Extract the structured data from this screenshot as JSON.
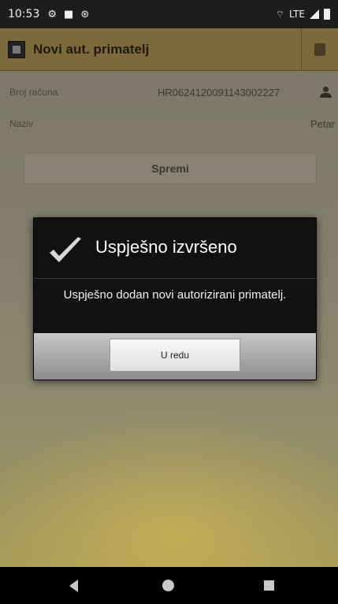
{
  "status_bar": {
    "time": "10:53",
    "network": "LTE"
  },
  "app": {
    "title": "Novi aut. primatelj",
    "fields": [
      {
        "label": "Broj računa",
        "value": "HR0624120091143002227"
      },
      {
        "label": "Naziv",
        "value": "Petar"
      }
    ],
    "save_button": "Spremi"
  },
  "dialog": {
    "title": "Uspješno izvršeno",
    "message": "Uspješno dodan novi autorizirani primatelj.",
    "ok_button": "U redu"
  },
  "icons": {
    "status": [
      "gear-icon",
      "sd-card-icon",
      "sync-icon"
    ],
    "title_action": "save-icon",
    "contact": "person-icon",
    "dialog": "checkmark-icon"
  },
  "colors": {
    "titlebar": "#7d6a3a",
    "dialog_bg": "#111111",
    "accent_gold": "#c9a94a"
  }
}
